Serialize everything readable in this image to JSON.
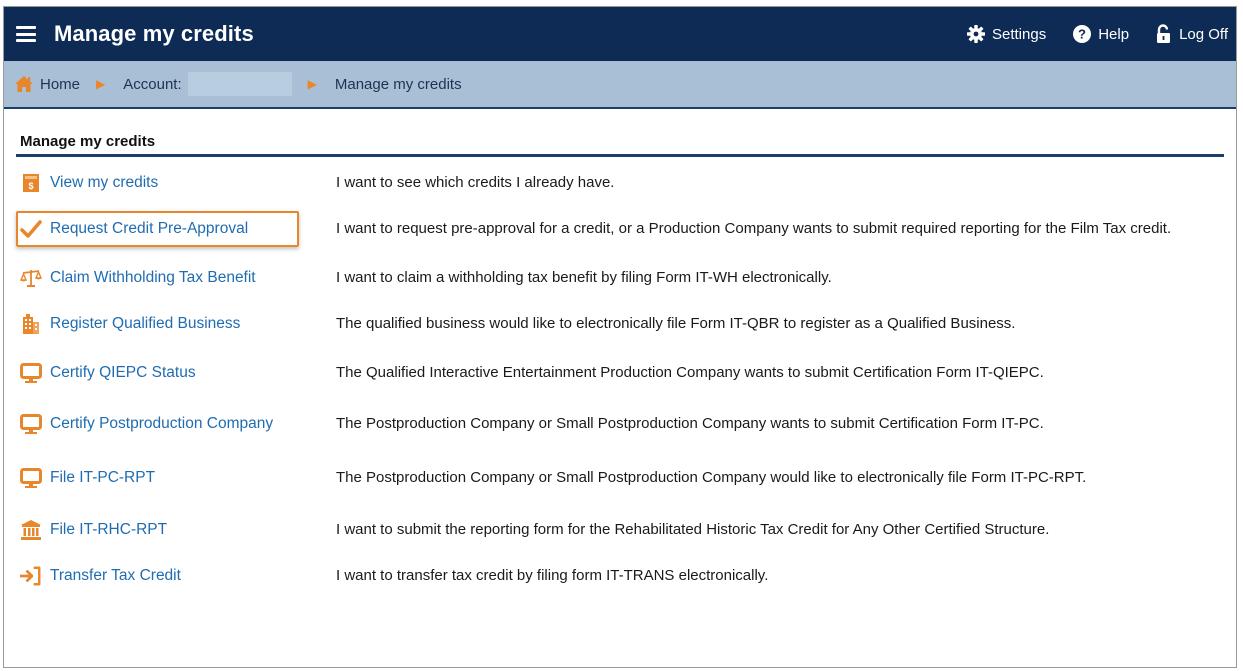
{
  "header": {
    "title": "Manage my credits",
    "settings_label": "Settings",
    "help_label": "Help",
    "logoff_label": "Log Off"
  },
  "breadcrumb": {
    "home": "Home",
    "account": "Account:",
    "current": "Manage my credits"
  },
  "section": {
    "title": "Manage my credits"
  },
  "items": [
    {
      "label": "View my credits",
      "icon": "receipt-icon",
      "desc": "I want to see which credits I already have."
    },
    {
      "label": "Request Credit Pre-Approval",
      "icon": "checkmark-icon",
      "desc": "I want to request pre-approval for a credit, or a Production Company wants to submit required reporting for the Film Tax credit."
    },
    {
      "label": "Claim Withholding Tax Benefit",
      "icon": "scales-icon",
      "desc": "I want to claim a withholding tax benefit by filing Form IT-WH electronically."
    },
    {
      "label": "Register Qualified Business",
      "icon": "building-icon",
      "desc": "The qualified business would like to electronically file Form IT-QBR to register as a Qualified Business."
    },
    {
      "label": "Certify QIEPC Status",
      "icon": "monitor-icon",
      "desc": "The Qualified Interactive Entertainment Production Company wants to submit Certification Form IT-QIEPC."
    },
    {
      "label": "Certify Postproduction Company",
      "icon": "monitor-icon",
      "desc": "The Postproduction Company or Small Postproduction Company wants to submit Certification Form IT-PC."
    },
    {
      "label": "File IT-PC-RPT",
      "icon": "monitor-icon",
      "desc": "The Postproduction Company or Small Postproduction Company would like to electronically file Form IT-PC-RPT."
    },
    {
      "label": "File IT-RHC-RPT",
      "icon": "bank-icon",
      "desc": "I want to submit the reporting form for the Rehabilitated Historic Tax Credit for Any Other Certified Structure."
    },
    {
      "label": "Transfer Tax Credit",
      "icon": "transfer-arrow-icon",
      "desc": "I want to transfer tax credit by filing form IT-TRANS electronically."
    }
  ],
  "colors": {
    "header_bg": "#0e2b55",
    "breadcrumb_bg": "#a8bfd5",
    "link": "#1f6cb1",
    "accent": "#e8862c"
  }
}
